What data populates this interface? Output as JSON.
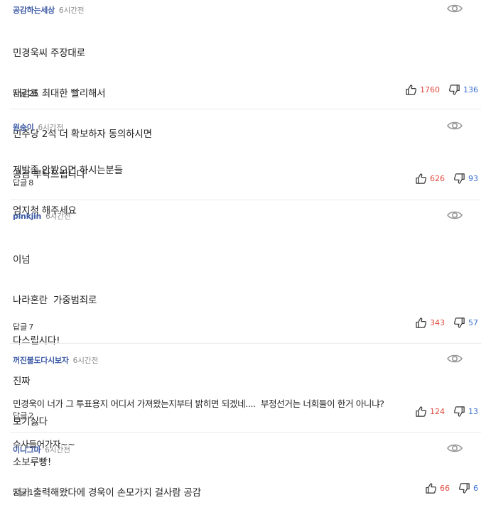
{
  "reply_label": "답글",
  "colors": {
    "author": "#3c5aa5",
    "like": "#e04a3c",
    "dislike": "#3b6fd1"
  },
  "comments": [
    {
      "author": "공감하는세상",
      "time": "6시간전",
      "lines": [
        "민경욱씨 주장대로",
        "재검표 최대한 빨리해서",
        "민주당 2석 더 확보하자 동의하시면",
        "공감 부탁드립니다"
      ],
      "replies": "25",
      "likes": "1760",
      "dislikes": "136"
    },
    {
      "author": "원숭이",
      "time": "6시간전",
      "lines": [
        "제발좀 안봤으면 하시는분들",
        "엄지척 해주세요"
      ],
      "replies": "8",
      "likes": "626",
      "dislikes": "93"
    },
    {
      "author": "pinkjin",
      "time": "6시간전",
      "lines": [
        "이넘",
        "나라혼란  가중범죄로",
        "다스립시다!",
        "진짜",
        "보기싫다",
        "소보루빵!"
      ],
      "replies": "7",
      "likes": "343",
      "dislikes": "57"
    },
    {
      "author": "꺼진불도다시보자",
      "time": "6시간전",
      "lines": [
        "민경욱이 너가 그 투표용지 어디서 가져왔는지부터 밝히면 되겠네....  부정선거는 너희들이 한거 아니냐?",
        "수사들어가자~~"
      ],
      "replies": "2",
      "likes": "124",
      "dislikes": "13"
    },
    {
      "author": "이니그마",
      "time": "6시간전",
      "lines": [
        "지가 출력해왔다에 경욱이 손모가지 걸사람 공감"
      ],
      "replies": "1",
      "likes": "66",
      "dislikes": "6"
    }
  ]
}
